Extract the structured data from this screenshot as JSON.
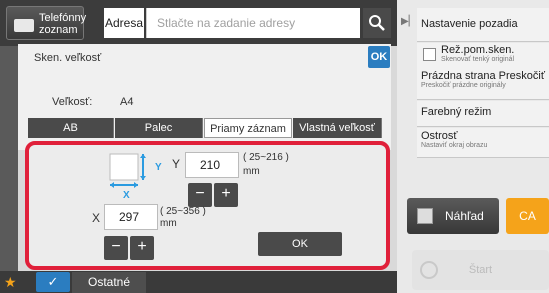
{
  "topbar": {
    "phonebook_label": "Telefónny zoznam",
    "address_label": "Adresa",
    "address_placeholder": "Stlačte na zadanie adresy"
  },
  "right_panel": {
    "items": [
      {
        "title": "Nastavenie pozadia",
        "sub": ""
      },
      {
        "title": "Rež.pom.sken.",
        "sub": "Skenovať tenký originál"
      },
      {
        "title": "Prázdna strana Preskočiť",
        "sub": "Preskočiť prázdne originály"
      },
      {
        "title": "Farebný režim",
        "sub": ""
      },
      {
        "title": "Ostrosť",
        "sub": "Nastaviť okraj obrazu"
      }
    ],
    "preview_label": "Náhľad",
    "ca_label": "CA",
    "start_label": "Štart"
  },
  "dialog": {
    "title": "Sken. veľkosť",
    "ok_label": "OK",
    "size_label": "Veľkosť:",
    "size_value": "A4",
    "tabs": [
      "AB",
      "Palec",
      "Priamy záznam",
      "Vlastná veľkosť"
    ],
    "active_tab": "Priamy záznam"
  },
  "direct_entry": {
    "y_label": "Y",
    "y_value": "210",
    "y_range": "( 25~216 )",
    "y_unit": "mm",
    "x_label": "X",
    "x_value": "297",
    "x_range": "( 25~356 )",
    "x_unit": "mm",
    "icon_y": "Y",
    "icon_x": "X",
    "minus": "−",
    "plus": "+",
    "ok_label": "OK"
  },
  "bottom": {
    "other_label": "Ostatné"
  },
  "colors": {
    "highlight": "#e0203a",
    "accent_blue": "#2b7dc0",
    "ca_orange": "#f5a31a"
  }
}
